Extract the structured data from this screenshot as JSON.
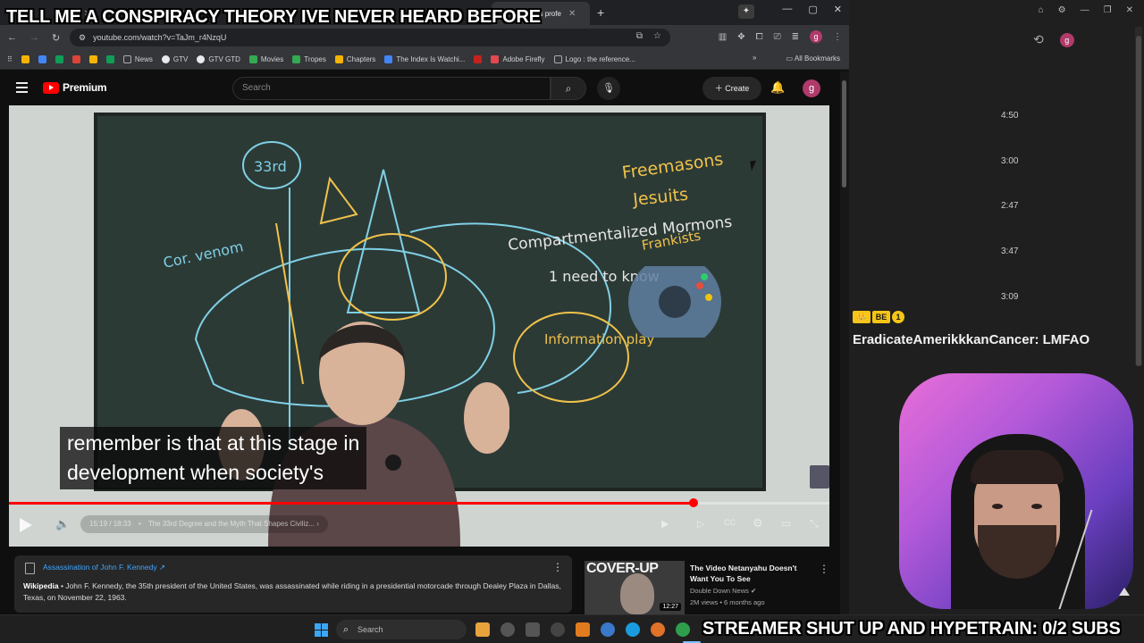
{
  "browser": {
    "tabs": [
      {
        "title": "",
        "active": false
      },
      {
        "title": "",
        "active": false
      },
      {
        "title": "",
        "active": false
      },
      {
        "title": "",
        "active": false
      },
      {
        "title": "",
        "active": false
      },
      {
        "title": "what does profe",
        "active": true
      }
    ],
    "url": "youtube.com/watch?v=TaJm_r4NzqU",
    "bookmarks": [
      {
        "label": "",
        "color": "#f4b400"
      },
      {
        "label": "",
        "color": "#4285f4"
      },
      {
        "label": "",
        "color": "#0f9d58"
      },
      {
        "label": "",
        "color": "#db4437"
      },
      {
        "label": "",
        "color": "#f4b400"
      },
      {
        "label": "",
        "color": "#0f9d58"
      },
      {
        "label": "News",
        "color": "#5f6368"
      },
      {
        "label": "GTV",
        "color": "#e8eaed"
      },
      {
        "label": "GTV GTD",
        "color": "#e8eaed"
      },
      {
        "label": "Movies",
        "color": "#34a853"
      },
      {
        "label": "Tropes",
        "color": "#34a853"
      },
      {
        "label": "Chapters",
        "color": "#f4b400"
      },
      {
        "label": "The Index Is Watchi...",
        "color": "#4285f4"
      },
      {
        "label": "",
        "color": "#c5221f"
      },
      {
        "label": "Adobe Firefly",
        "color": "#e34850"
      },
      {
        "label": "Logo : the reference...",
        "color": "#5f6368"
      }
    ],
    "all_bookmarks": "All Bookmarks"
  },
  "youtube": {
    "brand": "Premium",
    "search_placeholder": "Search",
    "create_label": "Create",
    "avatar_letter": "g"
  },
  "video": {
    "caption_line1": "remember is that at this stage in",
    "caption_line2": "development when society's",
    "time": "15:19 / 18:33",
    "chapter": "The 33rd Degree and the Myth That Shapes Civiliz...",
    "progress": 0.834,
    "board_text": [
      "Freemasons",
      "Jesuits",
      "Compartmentalized Mormons",
      "Frankists",
      "1 need to know",
      "Information play",
      "Cor. venom",
      "33rd"
    ]
  },
  "info_card": {
    "title": "Assassination of John F. Kennedy",
    "source": "Wikipedia",
    "body": "John F. Kennedy, the 35th president of the United States, was assassinated while riding in a presidential motorcade through Dealey Plaza in Dallas, Texas, on November 22, 1963."
  },
  "recommendation": {
    "thumb_text": "COVER-UP",
    "duration": "12:27",
    "title": "The Video Netanyahu Doesn't Want You To See",
    "channel": "Double Down News",
    "meta": "2M views • 6 months ago"
  },
  "side_panel": {
    "durations": [
      "4:50",
      "3:00",
      "2:47",
      "3:47",
      "3:09"
    ],
    "avatar_letter": "g"
  },
  "chat": {
    "badges": [
      "👑",
      "BE",
      "1"
    ],
    "badge_colors": [
      "#f5c518",
      "#f5c518",
      "#f5c518"
    ],
    "username": "EradicateAmerikkkanCancer:",
    "message": "LMFAO"
  },
  "overlay": {
    "top_text": "TELL ME A CONSPIRACY THEORY IVE NEVER HEARD BEFORE",
    "bottom_text": "STREAMER SHUT UP AND HYPETRAIN: 0/2 SUBS"
  },
  "taskbar": {
    "search_label": "Search",
    "apps": [
      "#e8a33d",
      "#555555",
      "#555555",
      "#444444",
      "#e07b1e",
      "#3a78c9",
      "#1a9be0",
      "#e0722a",
      "#2f9e4c"
    ]
  }
}
